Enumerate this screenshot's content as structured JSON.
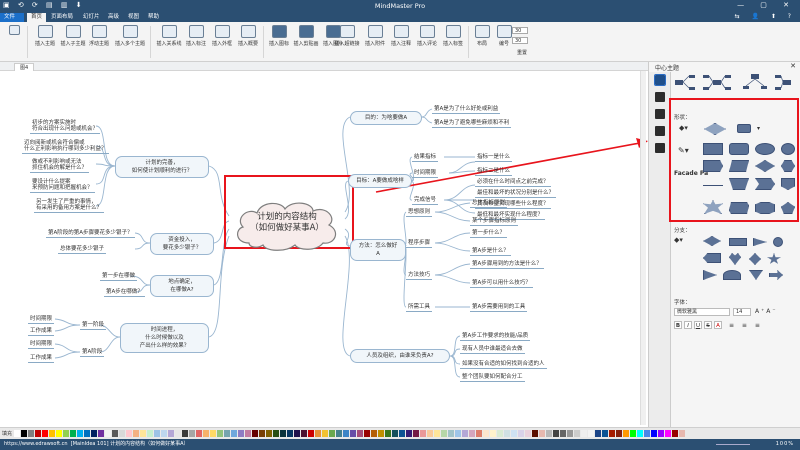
{
  "window": {
    "title": "MindMaster Pro"
  },
  "menu": {
    "tabs": [
      "文件",
      "首页",
      "页面布局",
      "幻灯片",
      "高级",
      "视图",
      "帮助"
    ]
  },
  "ribbon": {
    "items": [
      "插入主题",
      "插入子主题",
      "浮动主题",
      "插入多个主题",
      "插入关系线",
      "插入标注",
      "插入外框",
      "插入概要",
      "插入图标",
      "插入剪贴画",
      "插入图片",
      "插入超链接",
      "插入附件",
      "插入注释",
      "插入评论",
      "插入标签",
      "布局",
      "编号"
    ],
    "spin1": "30",
    "spin2": "30",
    "reset": "重置"
  },
  "doc": {
    "tab": "图4"
  },
  "mindmap": {
    "central": {
      "line1": "计划的内容结构",
      "line2": "（如何做好某事A）"
    },
    "right": [
      {
        "label": "目的：为啥要做A",
        "children": [
          "第A是为了什么好处或利益",
          "第A是为了避免哪些麻烦和不利"
        ]
      },
      {
        "label": "目标：A要做成啥样",
        "groups": [
          {
            "label": "结果指标",
            "children": [
              "指标一是什么"
            ]
          },
          {
            "label": "时间期限",
            "children": [
              "指标二是什么",
              "必须在什么时间点之前完成？"
            ]
          },
          {
            "label": "完成信号",
            "children": [
              "最佳和最坏的状况分别是什么？",
              "其次希望实现哪些什么程度？",
              "最低和最坏实现什么程度？"
            ]
          }
        ]
      },
      {
        "label": "方法：怎么做好A",
        "groups": [
          {
            "label": "思想原则",
            "children": [
              "总体指标原则",
              "某个步骤指标原则"
            ]
          },
          {
            "label": "程序步骤",
            "children": [
              "第一步什么？",
              "第A步是什么？"
            ]
          },
          {
            "label": "方法技巧",
            "children": [
              "第A步骤用到的方法是什么？",
              "第A步可以用什么技巧？"
            ]
          },
          {
            "label": "所需工具",
            "children": [
              "第A步需要用到的工具"
            ]
          }
        ]
      },
      {
        "label": "人员及组织，由谁来负责A?",
        "children": [
          "第A步工作要求的技能/品质",
          "现有人员中谁最适合去做",
          "如果没有合适的如何找到合适的人",
          "整个团队要如何配合分工"
        ]
      }
    ],
    "left": [
      {
        "line1": "计划的完善，",
        "line2": "如何使计划顺利的进行？",
        "children": [
          "初步的方案实施时",
          "符合出现什么问题或机会？",
          "迈向阅新或机会符合偏或",
          "什么正利影响执行哪到多少利益？",
          "做或不利影响或无法",
          "抓住机会的解是什么？",
          "要设计什么提案",
          "来预防问题和把握机会？",
          "另一发生了严重的事情，",
          "有采用的备用方案是什么？"
        ]
      },
      {
        "line1": "资金投入，",
        "line2": "要花多少银子？",
        "children": [
          "第A阶段的第A步骤要花多少银子？",
          "总体要花多少银子"
        ]
      },
      {
        "line1": "地点确定，",
        "line2": "在哪做A?",
        "children": [
          "第一步在哪做",
          "第A步在哪做？"
        ]
      },
      {
        "line1": "时间进程，",
        "line2": "什么时候做以及",
        "line3": "产出什么样的效果？",
        "groups": [
          {
            "label": "第一阶段",
            "children": [
              "时间期限",
              "工作成果"
            ]
          },
          {
            "label": "第A阶段",
            "children": [
              "时间期限",
              "工作成果"
            ]
          }
        ]
      }
    ]
  },
  "panel": {
    "title": "中心主题",
    "shape_label": "形状：",
    "facade": "Facade Pa",
    "branch_label": "分支：",
    "font_label": "字体：",
    "font_name": "微软雅黑",
    "font_size": "14",
    "font_buttons": [
      "B",
      "I",
      "U",
      "S",
      "A"
    ]
  },
  "colors": {
    "swatches": [
      "#ffffff",
      "#000000",
      "#7f7f7f",
      "#c00000",
      "#ff0000",
      "#ffc000",
      "#ffff00",
      "#92d050",
      "#00b050",
      "#00b0f0",
      "#0070c0",
      "#002060",
      "#7030a0",
      "#f2f2f2",
      "#595959",
      "#d9d9d9",
      "#ffc7ce",
      "#f4b183",
      "#ffe699",
      "#c6efce",
      "#9dc3e6",
      "#bdd7ee",
      "#b4a7d6",
      "#e7e6e6",
      "#3a3a3a",
      "#a6a6a6",
      "#e06666",
      "#f6b26b",
      "#ffd966",
      "#93c47d",
      "#76a5af",
      "#6fa8dc",
      "#8e7cc3",
      "#c27ba0",
      "#660000",
      "#783f04",
      "#7f6000",
      "#274e13",
      "#0c343d",
      "#073763",
      "#20124d",
      "#4c1130",
      "#cc0000",
      "#e69138",
      "#f1c232",
      "#6aa84f",
      "#45818e",
      "#3d85c6",
      "#674ea7",
      "#a64d79",
      "#990000",
      "#b45f06",
      "#bf9000",
      "#38761d",
      "#134f5c",
      "#0b5394",
      "#351c75",
      "#741b47",
      "#ea9999",
      "#f9cb9c",
      "#ffe599",
      "#b6d7a8",
      "#a2c4c9",
      "#9fc5e8",
      "#b4a7d6",
      "#d5a6bd",
      "#dd7e6b",
      "#fce5cd",
      "#fff2cc",
      "#d9ead3",
      "#d0e0e3",
      "#cfe2f3",
      "#d9d2e9",
      "#ead1dc",
      "#5b0f00",
      "#e6b8af",
      "#b7b7b7",
      "#434343",
      "#666666",
      "#999999",
      "#cccccc",
      "#efefef",
      "#f3f3f3",
      "#1c4587",
      "#0b5394",
      "#a61c00",
      "#85200c",
      "#ff9900",
      "#00ff00",
      "#00ffff",
      "#4a86e8",
      "#0000ff",
      "#9900ff",
      "#ff00ff",
      "#980000",
      "#e6b8af"
    ],
    "accent": "#e8141c",
    "connector": "#9ab6d0",
    "shape_fill": "#5b7195"
  },
  "status": {
    "fill": "填充",
    "url": "https://www.edrawsoft.cn",
    "info": "[MainIdea 101] 计划的内容结构（如何做好某事A）",
    "zoom": "100%"
  }
}
